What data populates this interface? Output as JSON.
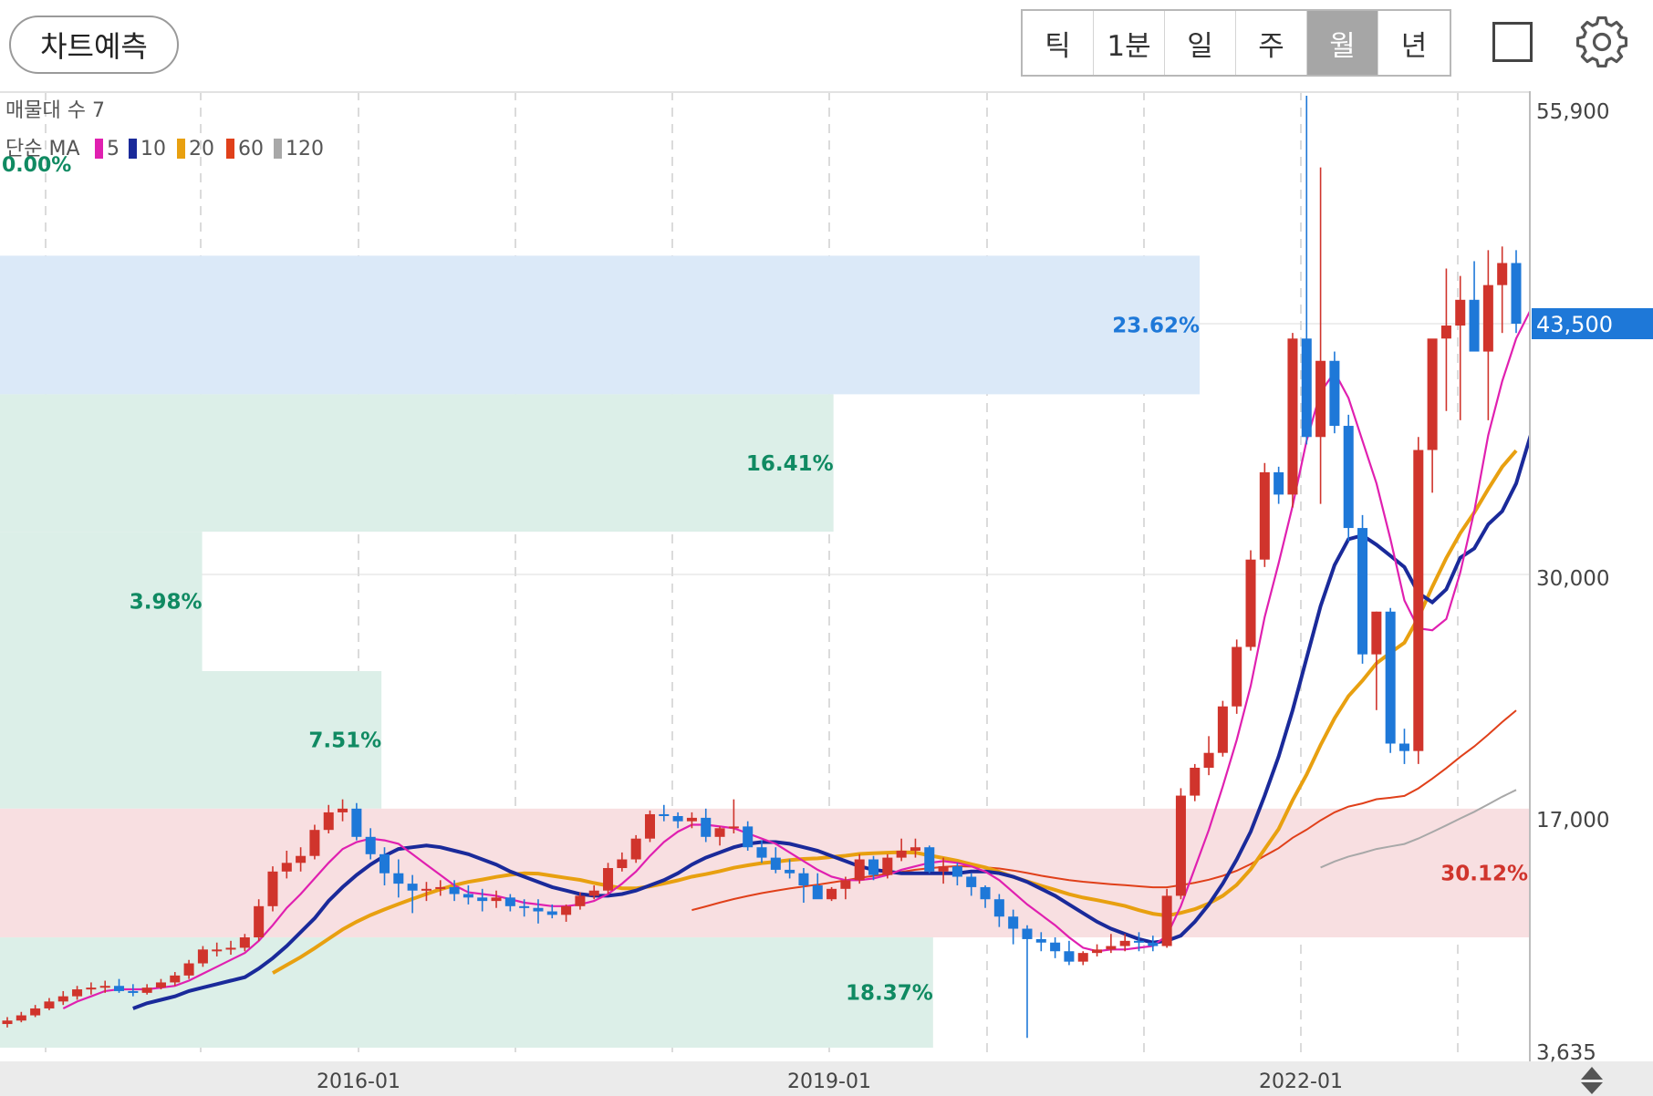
{
  "toolbar": {
    "predict_label": "차트예측",
    "periods": [
      "틱",
      "1분",
      "일",
      "주",
      "월",
      "년"
    ],
    "active_period": "월",
    "square_icon": "square-icon",
    "settings_icon": "gear-icon"
  },
  "colors": {
    "up": "#d0342c",
    "down": "#1e78d8",
    "ma5": "#e020b0",
    "ma10": "#1a2a9a",
    "ma20": "#e8a010",
    "ma60": "#e0401a",
    "ma120": "#a8a8a8",
    "price_tag": "#1e78d8"
  },
  "chart_data": {
    "type": "candlestick",
    "ylim": [
      3635,
      55900
    ],
    "y_ticks": [
      "55,900",
      "30,000",
      "17,000",
      "3,635"
    ],
    "x_ticks": [
      "2016-01",
      "2019-01",
      "2022-01"
    ],
    "current_price": "43,500",
    "legend": {
      "volume_profile": "매물대 수 7",
      "ma_type": "단순 MA",
      "ma_periods": [
        "5",
        "10",
        "20",
        "60",
        "120"
      ],
      "top_percent": "0.00%"
    },
    "volume_profile": [
      {
        "low": 39700,
        "high": 47200,
        "percent": "23.62%",
        "pct": 23.62,
        "kind": "blue"
      },
      {
        "low": 32300,
        "high": 39700,
        "percent": "16.41%",
        "pct": 16.41,
        "kind": "green"
      },
      {
        "low": 24800,
        "high": 32300,
        "percent": "3.98%",
        "pct": 3.98,
        "kind": "green"
      },
      {
        "low": 17400,
        "high": 24800,
        "percent": "7.51%",
        "pct": 7.51,
        "kind": "green"
      },
      {
        "low": 10000,
        "high": 17400,
        "percent": "30.12%",
        "pct": 30.12,
        "kind": "red"
      },
      {
        "low": 3635,
        "high": 10000,
        "percent": "18.37%",
        "pct": 18.37,
        "kind": "green"
      }
    ],
    "candles": [
      [
        5000,
        5400,
        4800,
        5200
      ],
      [
        5200,
        5700,
        5100,
        5500
      ],
      [
        5500,
        6100,
        5400,
        5900
      ],
      [
        5900,
        6500,
        5800,
        6300
      ],
      [
        6300,
        6900,
        6100,
        6600
      ],
      [
        6600,
        7200,
        6400,
        7000
      ],
      [
        7000,
        7400,
        6700,
        7100
      ],
      [
        7100,
        7500,
        6800,
        7200
      ],
      [
        7200,
        7600,
        6800,
        6900
      ],
      [
        6900,
        7300,
        6600,
        6800
      ],
      [
        6800,
        7300,
        6700,
        7100
      ],
      [
        7100,
        7600,
        7000,
        7400
      ],
      [
        7400,
        8000,
        7200,
        7800
      ],
      [
        7800,
        8700,
        7600,
        8500
      ],
      [
        8500,
        9500,
        8300,
        9300
      ],
      [
        9300,
        9700,
        8900,
        9300
      ],
      [
        9300,
        9800,
        9000,
        9400
      ],
      [
        9400,
        10200,
        9200,
        10000
      ],
      [
        10000,
        12200,
        9800,
        11800
      ],
      [
        11800,
        14100,
        11500,
        13800
      ],
      [
        13800,
        15000,
        13400,
        14300
      ],
      [
        14300,
        15200,
        13800,
        14700
      ],
      [
        14700,
        16500,
        14500,
        16200
      ],
      [
        16200,
        17600,
        16000,
        17200
      ],
      [
        17200,
        17900,
        16700,
        17400
      ],
      [
        17400,
        17700,
        15600,
        15800
      ],
      [
        15800,
        16300,
        14500,
        14800
      ],
      [
        14800,
        15200,
        13000,
        13700
      ],
      [
        13700,
        14500,
        12300,
        13100
      ],
      [
        13100,
        13600,
        11400,
        12700
      ],
      [
        12700,
        13200,
        12100,
        12800
      ],
      [
        12800,
        13300,
        12400,
        12900
      ],
      [
        12900,
        13300,
        12100,
        12500
      ],
      [
        12500,
        13000,
        11900,
        12300
      ],
      [
        12300,
        12800,
        11500,
        12100
      ],
      [
        12100,
        12700,
        11700,
        12300
      ],
      [
        12300,
        12500,
        11500,
        11800
      ],
      [
        11800,
        12200,
        11200,
        11700
      ],
      [
        11700,
        12200,
        10800,
        11500
      ],
      [
        11500,
        11900,
        11100,
        11300
      ],
      [
        11300,
        11900,
        10900,
        11800
      ],
      [
        11800,
        12600,
        11600,
        12400
      ],
      [
        12400,
        13000,
        12200,
        12700
      ],
      [
        12700,
        14300,
        12500,
        14000
      ],
      [
        14000,
        14900,
        13800,
        14500
      ],
      [
        14500,
        15900,
        14300,
        15700
      ],
      [
        15700,
        17300,
        15500,
        17100
      ],
      [
        17100,
        17600,
        16700,
        17000
      ],
      [
        17000,
        17200,
        16300,
        16700
      ],
      [
        16700,
        17200,
        16300,
        16900
      ],
      [
        16900,
        17400,
        15500,
        15800
      ],
      [
        15800,
        16400,
        15300,
        16300
      ],
      [
        16300,
        17900,
        16000,
        16400
      ],
      [
        16400,
        16700,
        15000,
        15200
      ],
      [
        15200,
        15600,
        14300,
        14600
      ],
      [
        14600,
        15200,
        13700,
        13900
      ],
      [
        13900,
        14500,
        13400,
        13700
      ],
      [
        13700,
        14000,
        12000,
        13000
      ],
      [
        13000,
        13700,
        12300,
        12200
      ],
      [
        12200,
        12900,
        12100,
        12800
      ],
      [
        12800,
        13500,
        12200,
        13300
      ],
      [
        13300,
        14800,
        13100,
        14500
      ],
      [
        14500,
        14700,
        13300,
        13600
      ],
      [
        13600,
        14800,
        13400,
        14600
      ],
      [
        14600,
        15700,
        14400,
        15000
      ],
      [
        15000,
        15700,
        14600,
        15200
      ],
      [
        15200,
        15300,
        13700,
        13800
      ],
      [
        13800,
        14600,
        13100,
        14100
      ],
      [
        14100,
        14300,
        13000,
        13500
      ],
      [
        13500,
        13700,
        12400,
        12900
      ],
      [
        12900,
        13000,
        11700,
        12200
      ],
      [
        12200,
        12500,
        10600,
        11200
      ],
      [
        11200,
        11600,
        9600,
        10500
      ],
      [
        10500,
        10700,
        4200,
        9900
      ],
      [
        9900,
        10300,
        9200,
        9700
      ],
      [
        9700,
        10000,
        8800,
        9200
      ],
      [
        9200,
        9800,
        8400,
        8600
      ],
      [
        8600,
        9200,
        8400,
        9100
      ],
      [
        9100,
        9600,
        8900,
        9300
      ],
      [
        9300,
        10200,
        9100,
        9500
      ],
      [
        9500,
        10200,
        9200,
        9800
      ],
      [
        9800,
        10300,
        9200,
        9700
      ],
      [
        9700,
        10100,
        9200,
        9500
      ],
      [
        9500,
        12800,
        9400,
        12400
      ],
      [
        12400,
        18500,
        12200,
        18100
      ],
      [
        18100,
        19800,
        17800,
        19600
      ],
      [
        19600,
        21300,
        19200,
        20400
      ],
      [
        20400,
        23200,
        20200,
        22900
      ],
      [
        22900,
        26500,
        22500,
        26100
      ],
      [
        26100,
        31300,
        25900,
        30800
      ],
      [
        30800,
        36000,
        30400,
        35500
      ],
      [
        35500,
        35800,
        33800,
        34300
      ],
      [
        34300,
        43000,
        33600,
        42700
      ],
      [
        42700,
        55900,
        37000,
        37400
      ],
      [
        37400,
        52000,
        33800,
        41500
      ],
      [
        41500,
        42000,
        37600,
        38000
      ],
      [
        38000,
        38600,
        31800,
        32500
      ],
      [
        32500,
        33200,
        25200,
        25700
      ],
      [
        25700,
        28000,
        22700,
        28000
      ],
      [
        28000,
        28200,
        20400,
        20900
      ],
      [
        20900,
        21700,
        19800,
        20500
      ],
      [
        20500,
        37400,
        19800,
        36700
      ],
      [
        36700,
        42000,
        34400,
        42700
      ],
      [
        42700,
        46500,
        38800,
        43400
      ],
      [
        43400,
        46100,
        38300,
        44800
      ],
      [
        44800,
        46900,
        42700,
        42000
      ],
      [
        42000,
        47500,
        38300,
        45600
      ],
      [
        45600,
        47700,
        43000,
        46800
      ],
      [
        46800,
        47500,
        43000,
        43500
      ]
    ],
    "ma5": [
      null,
      null,
      null,
      null,
      5900,
      6300,
      6600,
      6900,
      7000,
      7000,
      7000,
      7100,
      7200,
      7500,
      7900,
      8300,
      8700,
      9100,
      9800,
      10700,
      11700,
      12500,
      13400,
      14300,
      15100,
      15500,
      15700,
      15600,
      15400,
      14800,
      14200,
      13600,
      13000,
      12600,
      12500,
      12400,
      12200,
      12000,
      11900,
      11800,
      11800,
      11900,
      12100,
      12500,
      13100,
      13800,
      14700,
      15500,
      16100,
      16500,
      16500,
      16400,
      16300,
      16000,
      15700,
      15400,
      14900,
      14400,
      13900,
      13500,
      13300,
      13300,
      13400,
      13600,
      13900,
      14100,
      14300,
      14400,
      14300,
      14100,
      13800,
      13300,
      12600,
      11900,
      11300,
      10700,
      10000,
      9400,
      9200,
      9300,
      9300,
      9400,
      9500,
      10100,
      11800,
      14000,
      16200,
      18600,
      21100,
      24000,
      27700,
      30600,
      33700,
      37200,
      39800,
      40900,
      39500,
      37200,
      34900,
      31900,
      28600,
      27100,
      27000,
      27600,
      30100,
      33400,
      37500,
      40400,
      42700,
      44200,
      45600,
      45500
    ],
    "ma10": [
      null,
      null,
      null,
      null,
      null,
      null,
      null,
      null,
      null,
      5900,
      6200,
      6400,
      6600,
      6900,
      7100,
      7300,
      7500,
      7700,
      8200,
      8800,
      9500,
      10300,
      11100,
      12100,
      12900,
      13600,
      14200,
      14700,
      15100,
      15200,
      15300,
      15200,
      15000,
      14800,
      14500,
      14200,
      13800,
      13500,
      13200,
      12900,
      12700,
      12500,
      12400,
      12400,
      12500,
      12700,
      13000,
      13300,
      13700,
      14200,
      14600,
      14900,
      15200,
      15400,
      15500,
      15500,
      15400,
      15200,
      15000,
      14700,
      14400,
      14100,
      13900,
      13800,
      13700,
      13700,
      13700,
      13700,
      13700,
      13800,
      13800,
      13700,
      13500,
      13200,
      12800,
      12400,
      11900,
      11400,
      10900,
      10500,
      10200,
      9900,
      9700,
      9800,
      10100,
      10900,
      11900,
      13100,
      14500,
      16100,
      18100,
      20200,
      22700,
      25500,
      28300,
      30500,
      31900,
      32100,
      31600,
      31000,
      30400,
      29000,
      28500,
      29200,
      30900,
      31400,
      32700,
      33400,
      34900,
      37400,
      39800,
      42200
    ]
  }
}
